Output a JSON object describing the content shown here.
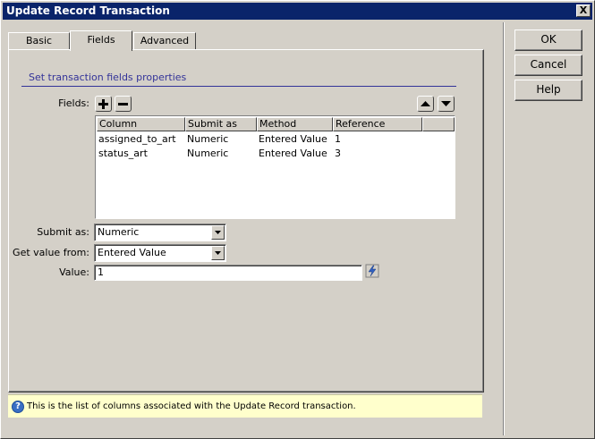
{
  "window": {
    "title": "Update Record Transaction",
    "close_glyph": "X"
  },
  "tabs": [
    {
      "label": "Basic",
      "active": false
    },
    {
      "label": "Fields",
      "active": true
    },
    {
      "label": "Advanced",
      "active": false
    }
  ],
  "section": {
    "heading": "Set transaction fields properties"
  },
  "fields": {
    "label": "Fields:",
    "add_glyph": "+",
    "remove_glyph": "−",
    "columns": [
      "Column",
      "Submit as",
      "Method",
      "Reference"
    ],
    "rows": [
      {
        "column": "assigned_to_art",
        "submit_as": "Numeric",
        "method": "Entered Value",
        "reference": "1"
      },
      {
        "column": "status_art",
        "submit_as": "Numeric",
        "method": "Entered Value",
        "reference": "3"
      }
    ]
  },
  "form": {
    "submit_as": {
      "label": "Submit as:",
      "value": "Numeric"
    },
    "get_value_from": {
      "label": "Get value from:",
      "value": "Entered Value"
    },
    "value": {
      "label": "Value:",
      "value": "1"
    }
  },
  "hint": {
    "text": "This is the list of columns associated with the Update Record transaction.",
    "icon_glyph": "?"
  },
  "buttons": {
    "ok": "OK",
    "cancel": "Cancel",
    "help": "Help"
  },
  "icons": {
    "add": "plus-icon",
    "remove": "minus-icon",
    "move_up": "arrow-up-icon",
    "move_down": "arrow-down-icon",
    "dynamic_data": "lightning-icon",
    "help": "help-icon",
    "close": "close-icon",
    "dropdown": "chevron-down-icon"
  },
  "colors": {
    "titlebar": "#0a246a",
    "hint_background": "#ffffcc",
    "heading_text": "#333399"
  }
}
